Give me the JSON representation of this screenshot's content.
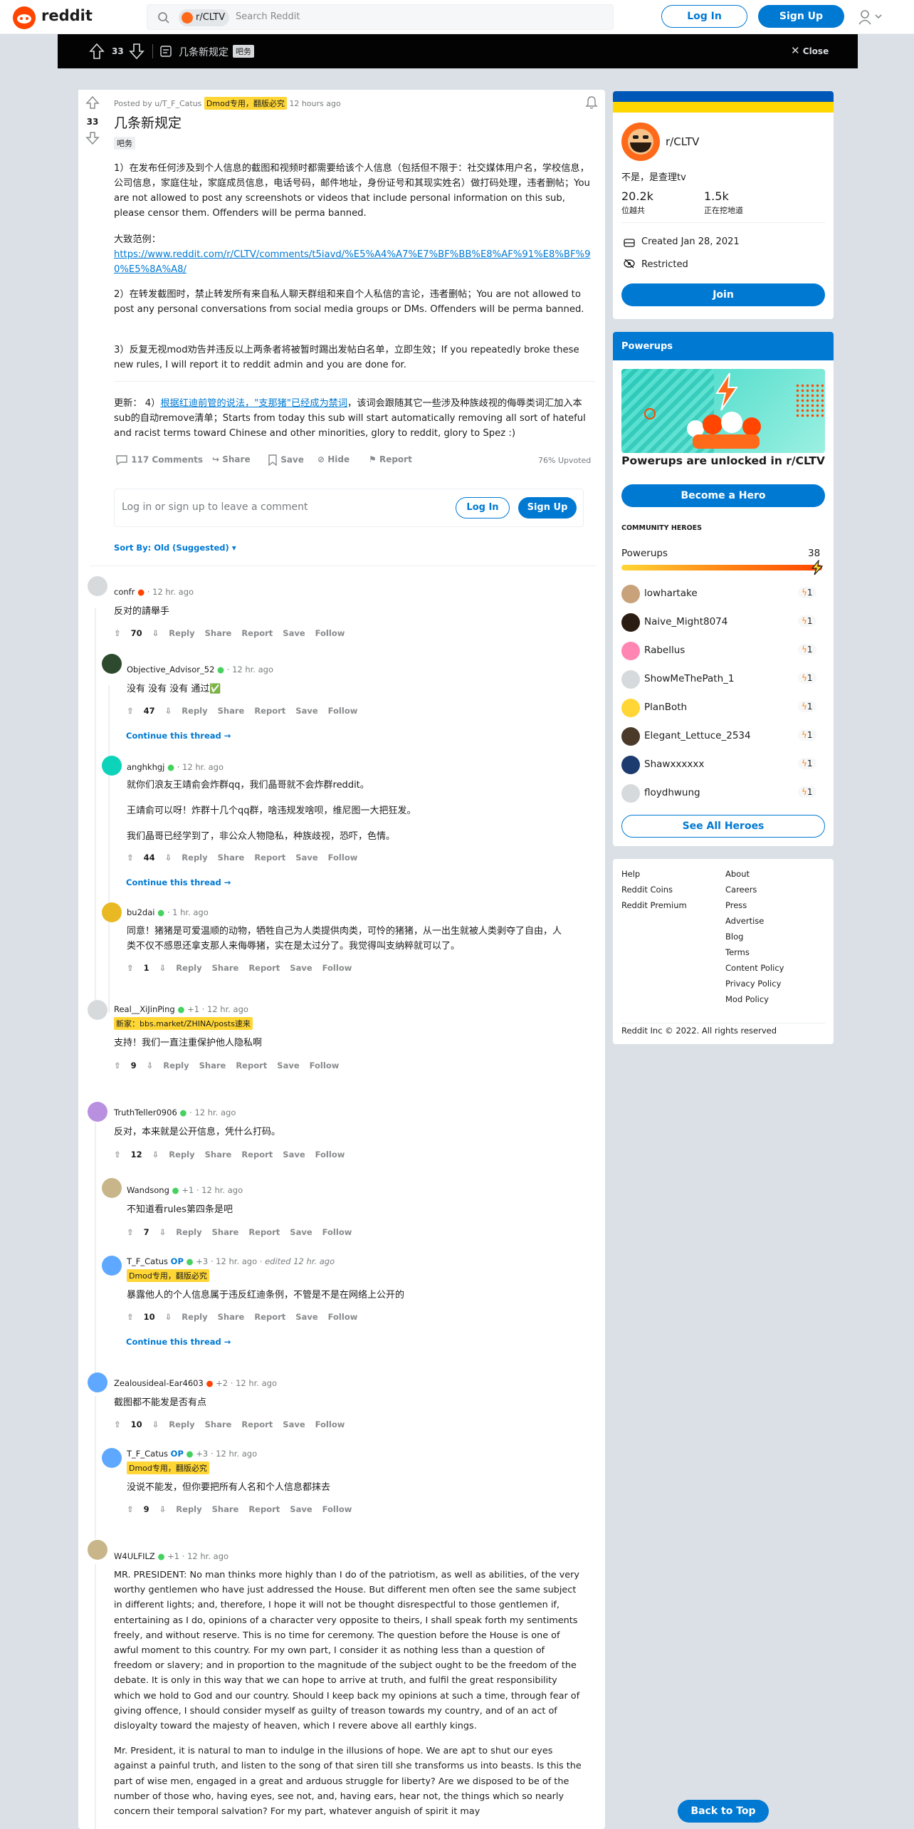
{
  "header": {
    "logo": "reddit",
    "search_chip": "r/CLTV",
    "search_placeholder": "Search Reddit",
    "login": "Log In",
    "signup": "Sign Up"
  },
  "topbar": {
    "votes": "33",
    "title": "几条新规定",
    "flair": "吧务",
    "close": "Close"
  },
  "post": {
    "posted_by": "Posted by u/T_F_Catus",
    "author_flair": "Dmod专用，翻版必究",
    "time": "12 hours ago",
    "votes": "33",
    "title": "几条新规定",
    "flair": "吧务",
    "p1": "1）在发布任何涉及到个人信息的截图和视频时都需要给该个人信息（包括但不限于：社交媒体用户名，学校信息，公司信息，家庭住址，家庭成员信息，电话号码，邮件地址，身份证号和其现实姓名）做打码处理，违者删帖；You are not allowed to post any screenshots or videos that include personal information on this sub, please censor them. Offenders will be perma banned.",
    "p2_label": "大致范例：",
    "p2_link": "https://www.reddit.com/r/CLTV/comments/t5iavd/%E5%A4%A7%E7%BF%BB%E8%AF%91%E8%BF%90%E5%8A%A8/",
    "p3": "2）在转发截图时，禁止转发所有来自私人聊天群组和来自个人私信的言论，违者删帖；You are not allowed to post any personal conversations from social media groups or DMs. Offenders will be perma banned.",
    "p4": "3）反复无视mod劝告并违反以上两条者将被暂时踢出发帖白名单，立即生效；If you repeatedly broke these new rules, I will report it to reddit admin and you are done for.",
    "p5_pre": "更新： 4）",
    "p5_link": "根据红迪前管的说法，\"支那猪\"已经成为禁词",
    "p5_post": "，该词会跟随其它一些涉及种族歧视的侮辱类词汇加入本sub的自动remove清单；Starts from today this sub will start automatically removing all sort of hateful and racist terms toward Chinese and other minorities, glory to reddit, glory to Spez :)",
    "comments": "117 Comments",
    "share": "Share",
    "save": "Save",
    "hide": "Hide",
    "report": "Report",
    "upvoted": "76% Upvoted",
    "comment_placeholder": "Log in or sign up to leave a comment",
    "login": "Log In",
    "signup": "Sign Up",
    "sort": "Sort By: Old (Suggested)"
  },
  "actions": {
    "reply": "Reply",
    "share": "Share",
    "report": "Report",
    "save": "Save",
    "follow": "Follow",
    "continue": "Continue this thread"
  },
  "comments": [
    {
      "author": "confr",
      "time": "12 hr. ago",
      "text": "反对的請舉手",
      "votes": "70"
    },
    {
      "author": "Objective_Advisor_52",
      "time": "12 hr. ago",
      "text": "没有 没有 没有 通过✅",
      "votes": "47"
    },
    {
      "author": "anghkhgj",
      "time": "12 hr. ago",
      "text": "就你们浪友王靖俞会炸群qq，我们晶哥就不会炸群reddit。",
      "text2": "王靖俞可以呀！炸群十几个qq群，啥违规发啥呗，维尼图一大把狂发。",
      "text3": "我们晶哥已经学到了，非公众人物隐私，种族歧视，恐吓，色情。",
      "votes": "44"
    },
    {
      "author": "bu2dai",
      "time": "1 hr. ago",
      "text": "同意！猪猪是可爱温顺的动物，牺牲自己为人类提供肉类，可怜的猪猪，从一出生就被人类剥夺了自由，人类不仅不感恩还拿支那人来侮辱猪，实在是太过分了。我觉得叫支纳粹就可以了。",
      "votes": "1"
    },
    {
      "author": "Real__XiJinPing",
      "extra": "+1",
      "time": "12 hr. ago",
      "flair": "新家：bbs.market/ZHINA/posts速来",
      "text": "支持！我们一直注重保护他人隐私啊",
      "votes": "9"
    },
    {
      "author": "TruthTeller0906",
      "time": "12 hr. ago",
      "text": "反对，本来就是公开信息，凭什么打码。",
      "votes": "12"
    },
    {
      "author": "Wandsong",
      "extra": "+1",
      "time": "12 hr. ago",
      "text": "不知道看rules第四条是吧",
      "votes": "7"
    },
    {
      "author": "T_F_Catus",
      "op": "OP",
      "extra": "+3",
      "time": "12 hr. ago",
      "edited": "edited 12 hr. ago",
      "flair": "Dmod专用，翻版必究",
      "text": "暴露他人的个人信息属于违反红迪条例，不管是不是在网络上公开的",
      "votes": "10"
    },
    {
      "author": "Zealousideal-Ear4603",
      "extra": "+2",
      "time": "12 hr. ago",
      "text": "截图都不能发是否有点",
      "votes": "10"
    },
    {
      "author": "T_F_Catus",
      "op": "OP",
      "extra": "+3",
      "time": "12 hr. ago",
      "flair": "Dmod专用，翻版必究",
      "text": "没说不能发，但你要把所有人名和个人信息都抹去",
      "votes": "9"
    },
    {
      "author": "W4ULFILZ",
      "extra": "+1",
      "time": "12 hr. ago",
      "text": "MR. PRESIDENT: No man thinks more highly than I do of the patriotism, as well as abilities, of the very worthy gentlemen who have just addressed the House. But different men often see the same subject in different lights; and, therefore, I hope it will not be thought disrespectful to those gentlemen if, entertaining as I do, opinions of a character very opposite to theirs, I shall speak forth my sentiments freely, and without reserve. This is no time for ceremony. The question before the House is one of awful moment to this country. For my own part, I consider it as nothing less than a question of freedom or slavery; and in proportion to the magnitude of the subject ought to be the freedom of the debate. It is only in this way that we can hope to arrive at truth, and fulfil the great responsibility which we hold to God and our country. Should I keep back my opinions at such a time, through fear of giving offence, I should consider myself as guilty of treason towards my country, and of an act of disloyalty toward the majesty of heaven, which I revere above all earthly kings.",
      "text2": "Mr. President, it is natural to man to indulge in the illusions of hope. We are apt to shut our eyes against a painful truth, and listen to the song of that siren till she transforms us into beasts. Is this the part of wise men, engaged in a great and arduous struggle for liberty? Are we disposed to be of the number of those who, having eyes, see not, and, having ears, hear not, the things which so nearly concern their temporal salvation? For my part, whatever anguish of spirit it may"
    }
  ],
  "sidebar": {
    "community": {
      "name": "r/CLTV",
      "desc": "不是，是查理tv",
      "members": "20.2k",
      "members_label": "位越共",
      "online": "1.5k",
      "online_label": "正在挖地道",
      "created": "Created Jan 28, 2021",
      "restricted": "Restricted",
      "join": "Join",
      "banner_colors": [
        "#0057b7",
        "#ffd700"
      ]
    },
    "powerups": {
      "title": "Powerups",
      "unlocked": "Powerups are unlocked in r/CLTV",
      "become": "Become a Hero",
      "heroes_label": "COMMUNITY HEROES",
      "powerups_label": "Powerups",
      "count": "38",
      "heroes": [
        {
          "name": "lowhartake",
          "badge": "1"
        },
        {
          "name": "Naive_Might8074",
          "badge": "1"
        },
        {
          "name": "Rabellus",
          "badge": "1"
        },
        {
          "name": "ShowMeThePath_1",
          "badge": "1"
        },
        {
          "name": "PlanBoth",
          "badge": "1"
        },
        {
          "name": "Elegant_Lettuce_2534",
          "badge": "1"
        },
        {
          "name": "Shawxxxxxx",
          "badge": "1"
        },
        {
          "name": "floydhwung",
          "badge": "1"
        }
      ],
      "see_all": "See All Heroes"
    },
    "footer": {
      "col1": [
        "Help",
        "Reddit Coins",
        "Reddit Premium"
      ],
      "col2": [
        "About",
        "Careers",
        "Press",
        "Advertise",
        "Blog",
        "Terms",
        "Content Policy",
        "Privacy Policy",
        "Mod Policy"
      ],
      "copyright": "Reddit Inc © 2022. All rights reserved"
    }
  },
  "back_to_top": "Back to Top"
}
